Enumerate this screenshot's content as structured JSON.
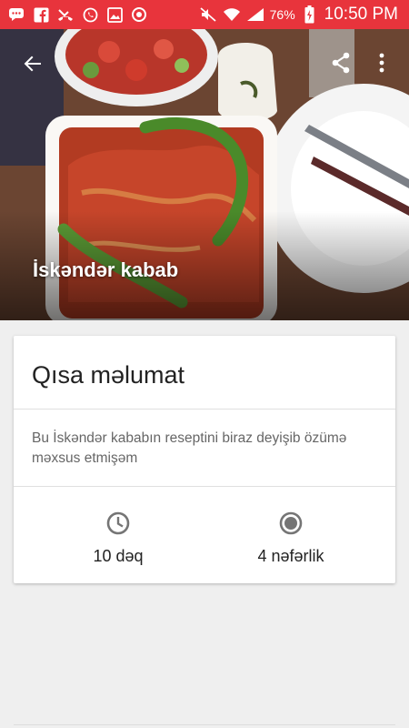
{
  "status_bar": {
    "battery_percent": "76%",
    "time": "10:50 PM"
  },
  "hero": {
    "title": "İskəndər kabab"
  },
  "card": {
    "title": "Qısa məlumat",
    "description": "Bu İskəndər kababın reseptini biraz deyişib özümə məxsus etmişəm",
    "time_label": "10 dəq",
    "servings_label": "4 nəfərlik"
  }
}
